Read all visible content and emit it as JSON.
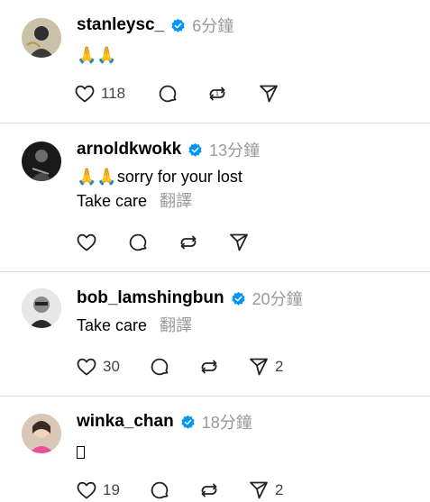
{
  "posts": [
    {
      "username": "stanleysc_",
      "time": "6分鐘",
      "text": "🙏🙏",
      "translate": "",
      "likes": "118",
      "shares": ""
    },
    {
      "username": "arnoldkwokk",
      "time": "13分鐘",
      "text": "🙏🙏sorry for your lost",
      "text2": "Take care",
      "translate": "翻譯",
      "likes": "",
      "shares": ""
    },
    {
      "username": "bob_lamshingbun",
      "time": "20分鐘",
      "text": "Take care",
      "translate": "翻譯",
      "likes": "30",
      "shares": "2"
    },
    {
      "username": "winka_chan",
      "time": "18分鐘",
      "text": "",
      "translate": "",
      "likes": "19",
      "shares": "2"
    }
  ],
  "icons": {
    "verified": "verified-badge-icon",
    "like": "heart-icon",
    "comment": "comment-bubble-icon",
    "repost": "repost-icon",
    "share": "send-icon"
  },
  "colors": {
    "verified": "#0095f6",
    "separator": "#dcdcdc",
    "muted": "#999999"
  }
}
